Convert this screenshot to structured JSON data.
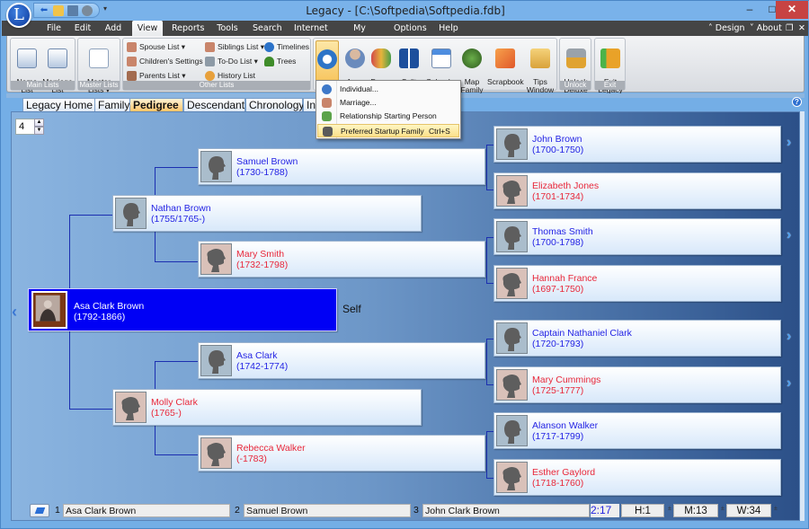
{
  "window": {
    "title": "Legacy - [C:\\Softpedia\\Softpedia.fdb]",
    "logo_letter": "L",
    "controls": {
      "minimize": "–",
      "maximize": "□",
      "close": "✕"
    }
  },
  "quick_access": {
    "icons": [
      "back-arrow-icon",
      "open-folder-icon",
      "computer-icon",
      "globe-icon"
    ],
    "more": "▾"
  },
  "menu": {
    "items": [
      "File",
      "Edit",
      "Add",
      "View",
      "Reports",
      "Tools",
      "Search",
      "Internet",
      "My Toolbar",
      "Options",
      "Help"
    ],
    "active": "View",
    "right": {
      "design": "˄ Design",
      "about": "˅ About",
      "restore": "❐",
      "close": "✕"
    }
  },
  "ribbon": {
    "groups": {
      "main_lists": {
        "label": "Main Lists",
        "buttons": [
          "Name\nList",
          "Marriage\nList"
        ]
      },
      "master_lists": {
        "label": "Master Lists",
        "buttons": [
          "Master\nLists ▾"
        ]
      },
      "other_lists": {
        "label": "Other Lists",
        "items": [
          "Spouse List ▾",
          "Children's Settings",
          "Parents List ▾",
          "Siblings List ▾",
          "To-Do List ▾",
          "History List",
          "Timelines",
          "Trees"
        ]
      },
      "navigate": {
        "buttons": [
          "Go\nTo ▾",
          "Ages",
          "Focus\nGroup",
          "Split\nScreen",
          "Calendar",
          "Map\nFamily",
          "Scrapbook",
          "Tips\nWindow"
        ]
      },
      "unlock": {
        "label": "Unlock",
        "buttons": [
          "Unlock\nDeluxe"
        ]
      },
      "exit": {
        "label": "Exit",
        "buttons": [
          "Exit\nLegacy"
        ]
      }
    }
  },
  "goto_menu": {
    "items": [
      {
        "label": "Individual...",
        "shortcut": ""
      },
      {
        "label": "Marriage...",
        "shortcut": ""
      },
      {
        "label": "Relationship Starting Person",
        "shortcut": ""
      },
      {
        "label": "Preferred Startup Family",
        "shortcut": "Ctrl+S"
      }
    ],
    "highlighted_index": 3
  },
  "tabs": {
    "items": [
      "Legacy Home",
      "Family",
      "Pedigree",
      "Descendant",
      "Chronology",
      "Ind"
    ],
    "active": "Pedigree"
  },
  "pedigree": {
    "generations": "4",
    "self_label": "Self",
    "people": {
      "self": {
        "name": "Asa Clark Brown",
        "dates": "(1792-1866)",
        "sex": "male"
      },
      "father": {
        "name": "Nathan Brown",
        "dates": "(1755/1765-)",
        "sex": "male"
      },
      "mother": {
        "name": "Molly Clark",
        "dates": "(1765-)",
        "sex": "female"
      },
      "pat_grandfather": {
        "name": "Samuel Brown",
        "dates": "(1730-1788)",
        "sex": "male"
      },
      "pat_grandmother": {
        "name": "Mary Smith",
        "dates": "(1732-1798)",
        "sex": "female"
      },
      "mat_grandfather": {
        "name": "Asa Clark",
        "dates": "(1742-1774)",
        "sex": "male"
      },
      "mat_grandmother": {
        "name": "Rebecca Walker",
        "dates": "(-1783)",
        "sex": "female"
      },
      "gg1": {
        "name": "John Brown",
        "dates": "(1700-1750)",
        "sex": "male"
      },
      "gg2": {
        "name": "Elizabeth Jones",
        "dates": "(1701-1734)",
        "sex": "female"
      },
      "gg3": {
        "name": "Thomas Smith",
        "dates": "(1700-1798)",
        "sex": "male"
      },
      "gg4": {
        "name": "Hannah France",
        "dates": "(1697-1750)",
        "sex": "female"
      },
      "gg5": {
        "name": "Captain Nathaniel Clark",
        "dates": "(1720-1793)",
        "sex": "male"
      },
      "gg6": {
        "name": "Mary Cummings",
        "dates": "(1725-1777)",
        "sex": "female"
      },
      "gg7": {
        "name": "Alanson Walker",
        "dates": "(1717-1799)",
        "sex": "male"
      },
      "gg8": {
        "name": "Esther Gaylord",
        "dates": "(1718-1760)",
        "sex": "female"
      }
    }
  },
  "status_bar": {
    "slots": [
      {
        "num": "1",
        "name": "Asa Clark Brown"
      },
      {
        "num": "2",
        "name": "Samuel Brown"
      },
      {
        "num": "3",
        "name": "John Clark Brown"
      }
    ],
    "time": "2:17",
    "h": "H:1",
    "m": "M:13",
    "w": "W:34",
    "pm": "±"
  },
  "colors": {
    "male_text": "#2424e4",
    "female_text": "#e8283a",
    "self_bg": "#0000f5",
    "menubar": "#454545",
    "line": "#1c2fb0"
  }
}
